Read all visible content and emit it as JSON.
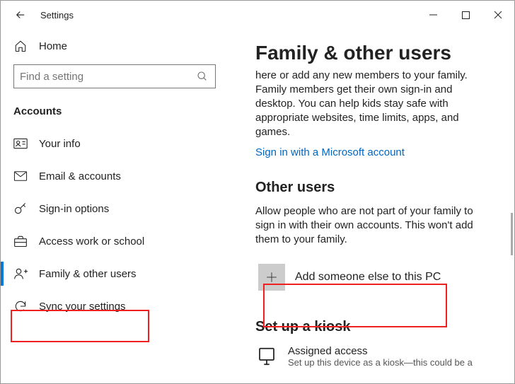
{
  "titlebar": {
    "title": "Settings"
  },
  "sidebar": {
    "home": "Home",
    "search_placeholder": "Find a setting",
    "section": "Accounts",
    "items": [
      {
        "label": "Your info"
      },
      {
        "label": "Email & accounts"
      },
      {
        "label": "Sign-in options"
      },
      {
        "label": "Access work or school"
      },
      {
        "label": "Family & other users"
      },
      {
        "label": "Sync your settings"
      }
    ]
  },
  "main": {
    "title": "Family & other users",
    "family_desc": "here or add any new members to your family. Family members get their own sign-in and desktop. You can help kids stay safe with appropriate websites, time limits, apps, and games.",
    "signin_link": "Sign in with a Microsoft account",
    "other_users_heading": "Other users",
    "other_users_desc": "Allow people who are not part of your family to sign in with their own accounts. This won't add them to your family.",
    "add_label": "Add someone else to this PC",
    "kiosk_heading": "Set up a kiosk",
    "assigned_title": "Assigned access",
    "assigned_desc": "Set up this device as a kiosk—this could be a"
  }
}
